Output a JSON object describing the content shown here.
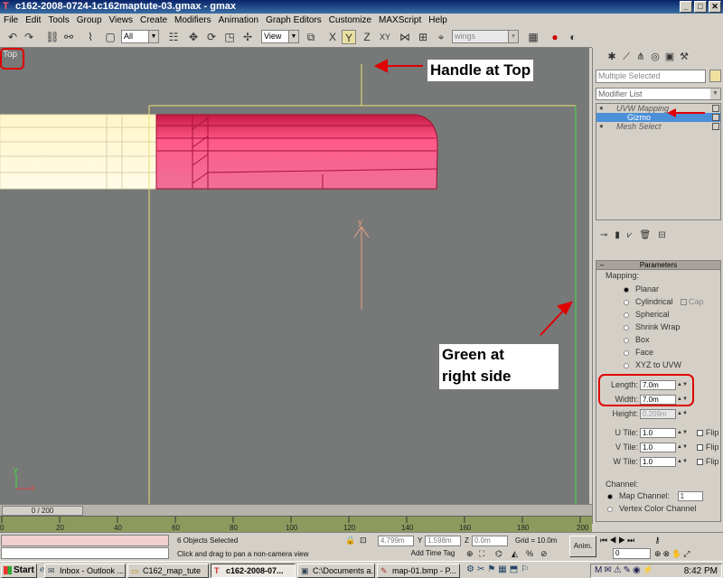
{
  "window": {
    "title": "c162-2008-0724-1c162maptute-03.gmax - gmax",
    "buttons": {
      "minimize": "_",
      "maximize": "□",
      "close": "✕"
    }
  },
  "menu": [
    "File",
    "Edit",
    "Tools",
    "Group",
    "Views",
    "Create",
    "Modifiers",
    "Animation",
    "Graph Editors",
    "Customize",
    "MAXScript",
    "Help"
  ],
  "toolbar": {
    "selection_filter": "All",
    "ref_coord": "View",
    "named_selection": "wings"
  },
  "viewport": {
    "label": "Top",
    "gizmo_axis": "y",
    "axis_tripod": {
      "x": "x",
      "y": "y"
    }
  },
  "annotations": {
    "handle": "Handle at Top",
    "green_line1": "Green at",
    "green_line2": "right side"
  },
  "command_panel": {
    "object_name": "Multiple Selected",
    "modifier_list": "Modifier List",
    "stack": [
      "UVW Mapping",
      "Gizmo",
      "Mesh Select"
    ],
    "params": {
      "rollout_title": "Parameters",
      "mapping_group": "Mapping:",
      "mapping_types": [
        "Planar",
        "Cylindrical",
        "Spherical",
        "Shrink Wrap",
        "Box",
        "Face",
        "XYZ to UVW"
      ],
      "cap_label": "Cap",
      "length_label": "Length:",
      "length_value": "7.0m",
      "width_label": "Width:",
      "width_value": "7.0m",
      "height_label": "Height:",
      "height_value": "0.209m",
      "utile_label": "U Tile:",
      "utile_value": "1.0",
      "vtile_label": "V Tile:",
      "vtile_value": "1.0",
      "wtile_label": "W Tile:",
      "wtile_value": "1.0",
      "flip_label": "Flip",
      "channel_group": "Channel:",
      "map_channel_label": "Map Channel:",
      "map_channel_value": "1",
      "vertex_color_label": "Vertex Color Channel"
    }
  },
  "time": {
    "frame": "0 / 200",
    "ruler_labels": [
      "0",
      "20",
      "40",
      "60",
      "80",
      "100",
      "120",
      "140",
      "160",
      "180",
      "200"
    ]
  },
  "status": {
    "selected": "6 Objects Selected",
    "prompt": "Click and drag to pan a non-camera view",
    "x_value": "4.799m",
    "y_label": "Y",
    "y_value": "1.598m",
    "z_label": "Z",
    "z_value": "0.0m",
    "grid": "Grid = 10.0m",
    "add_time_tag": "Add Time Tag",
    "anim": "Anim.",
    "frame_field": "0"
  },
  "taskbar": {
    "start": "Start",
    "tasks": [
      "Inbox - Outlook ...",
      "C162_map_tute",
      "c162-2008-07...",
      "C:\\Documents a...",
      "map-01.bmp - P..."
    ],
    "clock": "8:42 PM"
  },
  "colors": {
    "viewport_bg": "#777878",
    "object_pink": "#e8306a",
    "object_cream": "#fff8d0",
    "gizmo_yellow": "#e8e070",
    "gizmo_green": "#40e040",
    "annotation_red": "#e00000"
  }
}
